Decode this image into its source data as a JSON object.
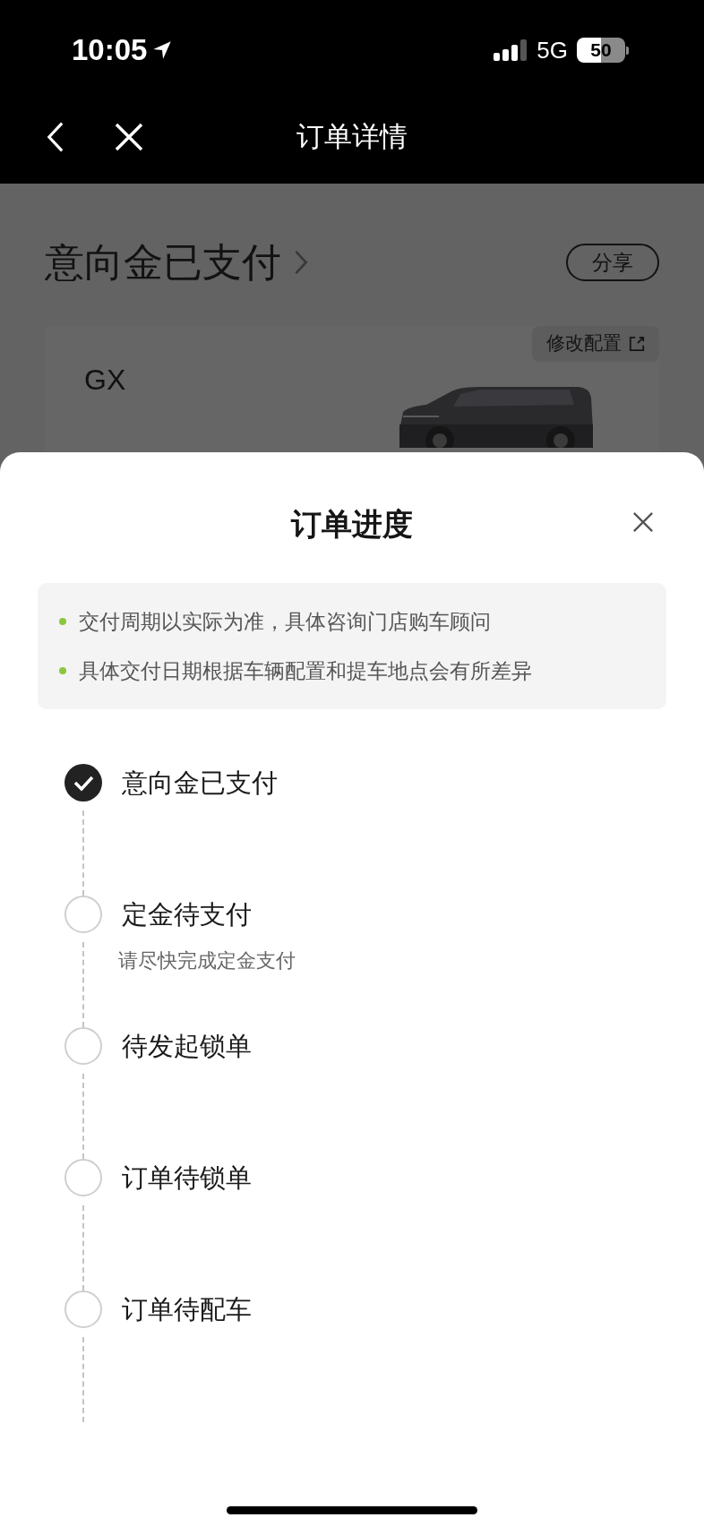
{
  "status_bar": {
    "time": "10:05",
    "network": "5G",
    "battery": "50"
  },
  "nav": {
    "title": "订单详情"
  },
  "order": {
    "status": "意向金已支付",
    "share": "分享",
    "card": {
      "edit": "修改配置",
      "model": "GX"
    }
  },
  "sheet": {
    "title": "订单进度",
    "notes": [
      "交付周期以实际为准，具体咨询门店购车顾问",
      "具体交付日期根据车辆配置和提车地点会有所差异"
    ],
    "steps": [
      {
        "label": "意向金已支付",
        "done": true
      },
      {
        "label": "定金待支付",
        "done": false,
        "note": "请尽快完成定金支付"
      },
      {
        "label": "待发起锁单",
        "done": false
      },
      {
        "label": "订单待锁单",
        "done": false
      },
      {
        "label": "订单待配车",
        "done": false
      }
    ]
  }
}
